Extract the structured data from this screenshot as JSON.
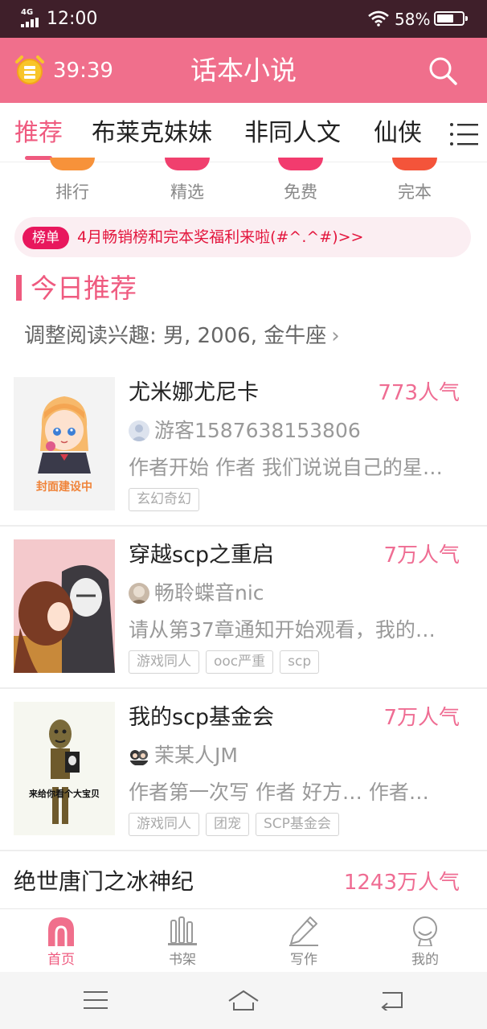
{
  "status_bar": {
    "network": "4G",
    "time": "12:00",
    "battery_percent": "58%",
    "battery_level": 0.58,
    "icons": [
      "signal-icon",
      "wifi-icon",
      "battery-icon"
    ]
  },
  "header": {
    "timer": "39:39",
    "title": "话本小说",
    "icons": [
      "alarm-clock-icon",
      "search-icon"
    ],
    "accent_color": "#f06f8c"
  },
  "tabs": [
    {
      "label": "推荐",
      "active": true
    },
    {
      "label": "布莱克妹妹",
      "active": false
    },
    {
      "label": "非同人文",
      "active": false
    },
    {
      "label": "仙侠",
      "active": false
    }
  ],
  "quick_categories": [
    {
      "label": "排行",
      "color": "#f7923a"
    },
    {
      "label": "精选",
      "color": "#f0406e"
    },
    {
      "label": "免费",
      "color": "#f23b6e"
    },
    {
      "label": "完本",
      "color": "#f4543a"
    }
  ],
  "notice": {
    "badge": "榜单",
    "text": "4月畅销榜和完本奖福利来啦(#^.^#)>>"
  },
  "section": {
    "title": "今日推荐",
    "interest": "调整阅读兴趣: 男, 2006, 金牛座",
    "interest_chevron": "›"
  },
  "books": [
    {
      "title": "尤米娜尤尼卡",
      "popularity": "773人气",
      "author": "游客1587638153806",
      "description": "作者开始 作者 我们说说自己的星…",
      "tags": [
        "玄幻奇幻"
      ],
      "cover_text": "封面建设中"
    },
    {
      "title": "穿越scp之重启",
      "popularity": "7万人气",
      "author": "畅聆蝶音nic",
      "description": "请从第37章通知开始观看，我的…",
      "tags": [
        "游戏同人",
        "ooc严重",
        "scp"
      ]
    },
    {
      "title": "我的scp基金会",
      "popularity": "7万人气",
      "author": "茉某人JM",
      "description": "作者第一次写  作者  好方… 作者…",
      "tags": [
        "游戏同人",
        "团宠",
        "SCP基金会"
      ],
      "cover_text": "来给你看个大宝贝"
    },
    {
      "title": "绝世唐门之冰神纪",
      "popularity": "1243万人气"
    }
  ],
  "bottom_nav": [
    {
      "label": "首页",
      "icon": "home-icon",
      "active": true
    },
    {
      "label": "书架",
      "icon": "bookshelf-icon",
      "active": false
    },
    {
      "label": "写作",
      "icon": "pencil-icon",
      "active": false
    },
    {
      "label": "我的",
      "icon": "profile-icon",
      "active": false
    }
  ],
  "system_nav": [
    "menu-icon",
    "home-icon",
    "back-icon"
  ]
}
